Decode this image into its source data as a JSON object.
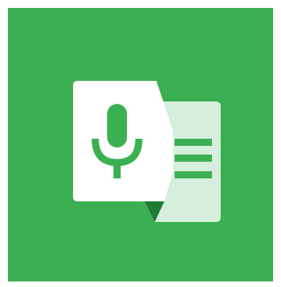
{
  "app_icon": {
    "name": "voice-notes-app-icon",
    "colors": {
      "background": "#3daf53",
      "card_front": "#ffffff",
      "card_back": "#d6eedc",
      "fold": "#1f7a34",
      "accent": "#3daf53"
    },
    "icons": [
      "microphone-icon",
      "document-lines-icon"
    ]
  }
}
